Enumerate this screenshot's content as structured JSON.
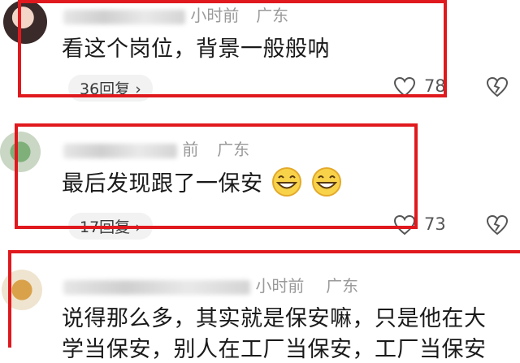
{
  "colors": {
    "highlight": "#e0191e",
    "meta": "#9a9a9a",
    "reply_bg": "#f2f2f2"
  },
  "comments": [
    {
      "meta_time": "小时前",
      "meta_location": "广东",
      "text": "看这个岗位，背景一般般呐",
      "reply_label": "36回复 ›",
      "like_count": "78",
      "like_icon": "heart-outline-icon",
      "dislike_icon": "broken-heart-icon"
    },
    {
      "meta_time": "前",
      "meta_location": "广东",
      "text": "最后发现跟了一保安",
      "emojis": [
        "grinning-face-emoji",
        "grinning-face-emoji"
      ],
      "reply_label": "17回复 ›",
      "like_count": "73",
      "like_icon": "heart-outline-icon",
      "dislike_icon": "broken-heart-icon"
    },
    {
      "meta_time": "小时前",
      "meta_location": "广东",
      "text_line1": "说得那么多，其实就是保安嘛，只是他在大",
      "text_line2": "学当保安，别人在工厂当保安，工厂当保安"
    }
  ]
}
